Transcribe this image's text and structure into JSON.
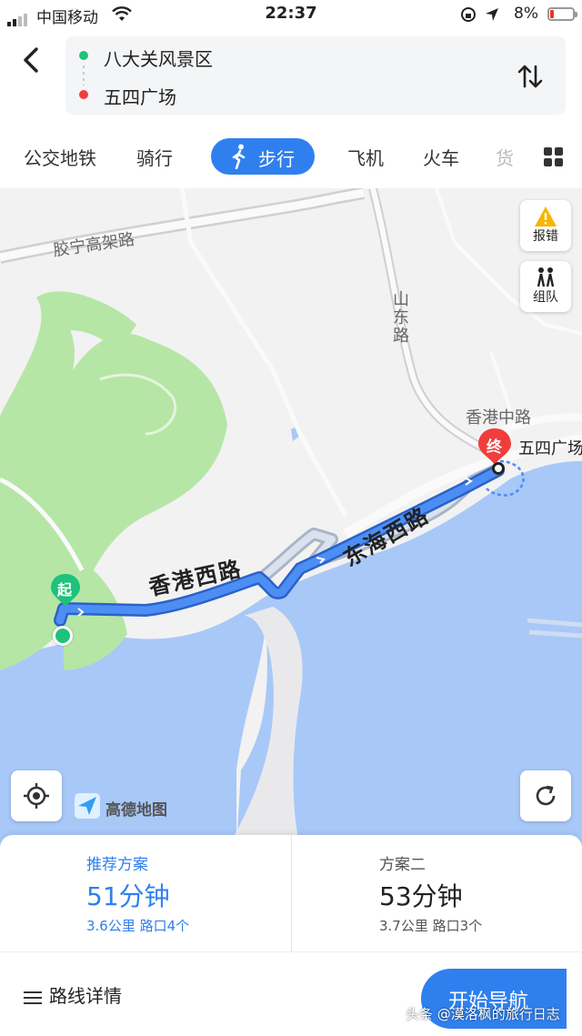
{
  "status_bar": {
    "carrier": "中国移动",
    "time": "22:37",
    "battery_percent": "8%"
  },
  "header": {
    "start_location": "八大关风景区",
    "end_location": "五四广场"
  },
  "mode_tabs": {
    "items": [
      "公交地铁",
      "骑行",
      "步行",
      "飞机",
      "火车",
      "货"
    ],
    "active": "步行"
  },
  "map": {
    "road_labels": {
      "jiaoning": "胶宁高架路",
      "shandong": "山东路",
      "xianggang_zhong": "香港中路",
      "xianggang_xi": "香港西路",
      "donghai_xi": "东海西路"
    },
    "start_marker": "起",
    "end_marker": "终",
    "end_label": "五四广场",
    "report_button": "报错",
    "team_button": "组队",
    "logo_text": "高德地图"
  },
  "plans": [
    {
      "name": "推荐方案",
      "duration": "51分钟",
      "meta": "3.6公里 路口4个",
      "selected": true
    },
    {
      "name": "方案二",
      "duration": "53分钟",
      "meta": "3.7公里 路口3个",
      "selected": false
    }
  ],
  "bottom_bar": {
    "details_label": "路线详情",
    "start_button": "开始导航"
  },
  "watermark": "头条 @漠洛枫的旅行日志",
  "colors": {
    "accent": "#2f80ee",
    "start_green": "#1ec27a",
    "end_red": "#f23d3d",
    "water": "#a8c8f8",
    "park": "#b6e6a6"
  }
}
